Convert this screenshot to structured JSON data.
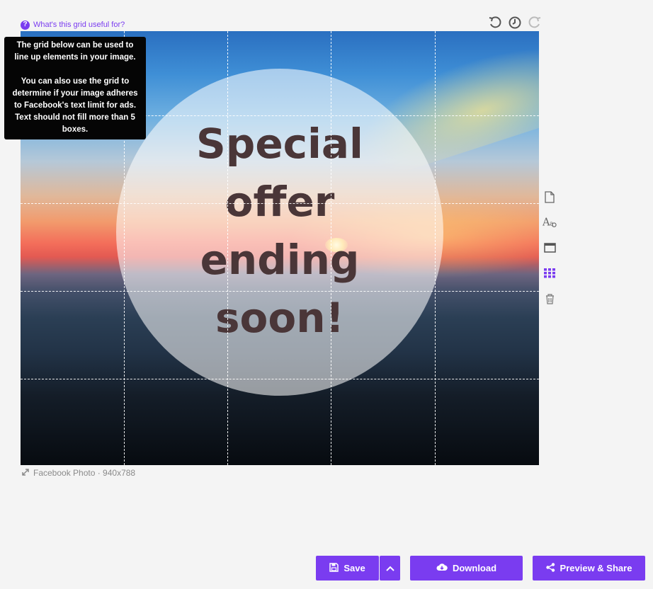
{
  "help": {
    "link_text": "What's this grid useful for?",
    "icon": "question-circle-icon"
  },
  "tooltip": {
    "line1": "The grid below can be used to line up elements in your image.",
    "line2": "You can also use the grid to determine if your image adheres to Facebook's text limit for ads. Text should not fill more than 5 boxes."
  },
  "history_tools": [
    "undo-icon",
    "history-clock-icon",
    "redo-icon"
  ],
  "canvas": {
    "headline_lines": [
      "Special",
      "offer",
      "ending",
      "soon!"
    ],
    "text_color": "#4a3638",
    "overlay_color": "rgba(255,255,255,0.56)"
  },
  "size": {
    "label": "Facebook Photo · 940x788",
    "icon": "resize-arrows-icon"
  },
  "side_tools": [
    "page-icon",
    "text-style-icon",
    "window-icon",
    "grid-icon",
    "trash-icon"
  ],
  "buttons": {
    "save": "Save",
    "download": "Download",
    "preview": "Preview & Share"
  },
  "colors": {
    "accent": "#7a3cf0",
    "background": "#f4f4f4",
    "tooltip_bg": "#050505"
  }
}
